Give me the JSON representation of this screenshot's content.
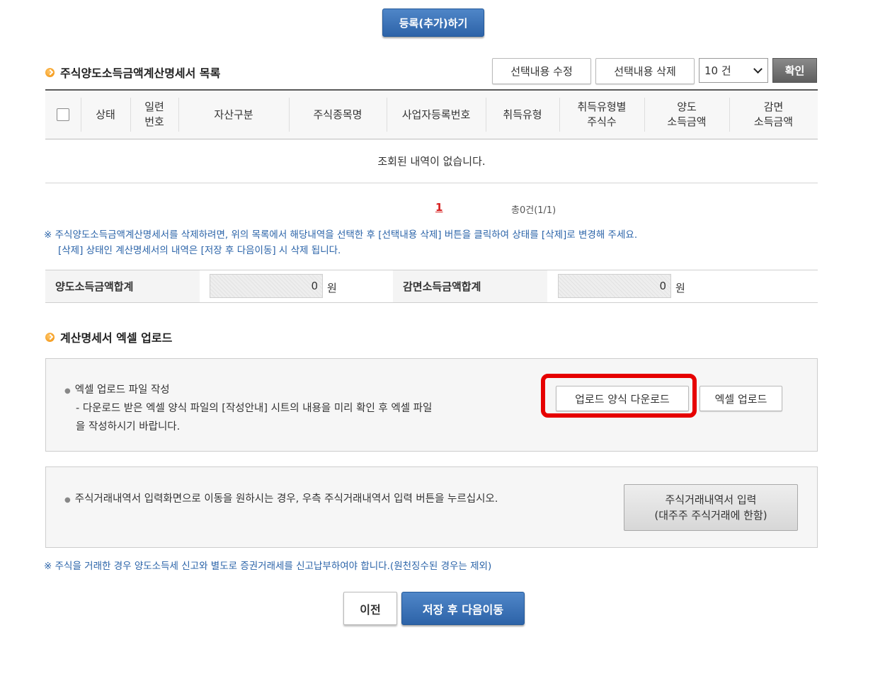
{
  "top_register_button": "등록(추가)하기",
  "list_section": {
    "title": "주식양도소득금액계산명세서 목록",
    "edit_button": "선택내용 수정",
    "delete_button": "선택내용 삭제",
    "page_size_select": "10 건",
    "confirm_button": "확인"
  },
  "table": {
    "headers": [
      "상태",
      "일련\n번호",
      "자산구분",
      "주식종목명",
      "사업자등록번호",
      "취득유형",
      "취득유형별\n주식수",
      "양도\n소득금액",
      "감면\n소득금액"
    ],
    "empty_message": "조회된 내역이 없습니다."
  },
  "pagination": {
    "current_page": "1",
    "summary": "총0건(1/1)"
  },
  "notes": {
    "delete_note_line1": "※ 주식양도소득금액계산명세서를 삭제하려면, 위의 목록에서 해당내역을 선택한 후 [선택내용 삭제] 버튼을 클릭하여 상태를 [삭제]로 변경해 주세요.",
    "delete_note_line2": "[삭제] 상태인 계산명세서의 내역은 [저장 후 다음이동] 시 삭제 됩니다.",
    "tax_note": "※ 주식을 거래한 경우 양도소득세 신고와 별도로 증권거래세를 신고납부하여야 합니다.(원천징수된 경우는 제외)"
  },
  "totals": {
    "transfer_label": "양도소득금액합계",
    "transfer_value": "0",
    "transfer_unit": "원",
    "reduction_label": "감면소득금액합계",
    "reduction_value": "0",
    "reduction_unit": "원"
  },
  "excel_section": {
    "title": "계산명세서 엑셀 업로드",
    "heading": "엑셀 업로드 파일 작성",
    "desc_line1": "- 다운로드 받은 엑셀 양식 파일의 [작성안내] 시트의 내용을 미리 확인 후 엑셀 파일",
    "desc_line2": "을 작성하시기 바랍니다.",
    "download_button": "업로드 양식 다운로드",
    "upload_button": "엑셀 업로드",
    "highlight_color": "#e60000"
  },
  "trade_section": {
    "text": "주식거래내역서 입력화면으로 이동을 원하시는 경우, 우측 주식거래내역서 입력 버튼을 누르십시오.",
    "button_line1": "주식거래내역서 입력",
    "button_line2": "(대주주 주식거래에 한함)"
  },
  "footer": {
    "prev_button": "이전",
    "save_next_button": "저장 후 다음이동"
  }
}
